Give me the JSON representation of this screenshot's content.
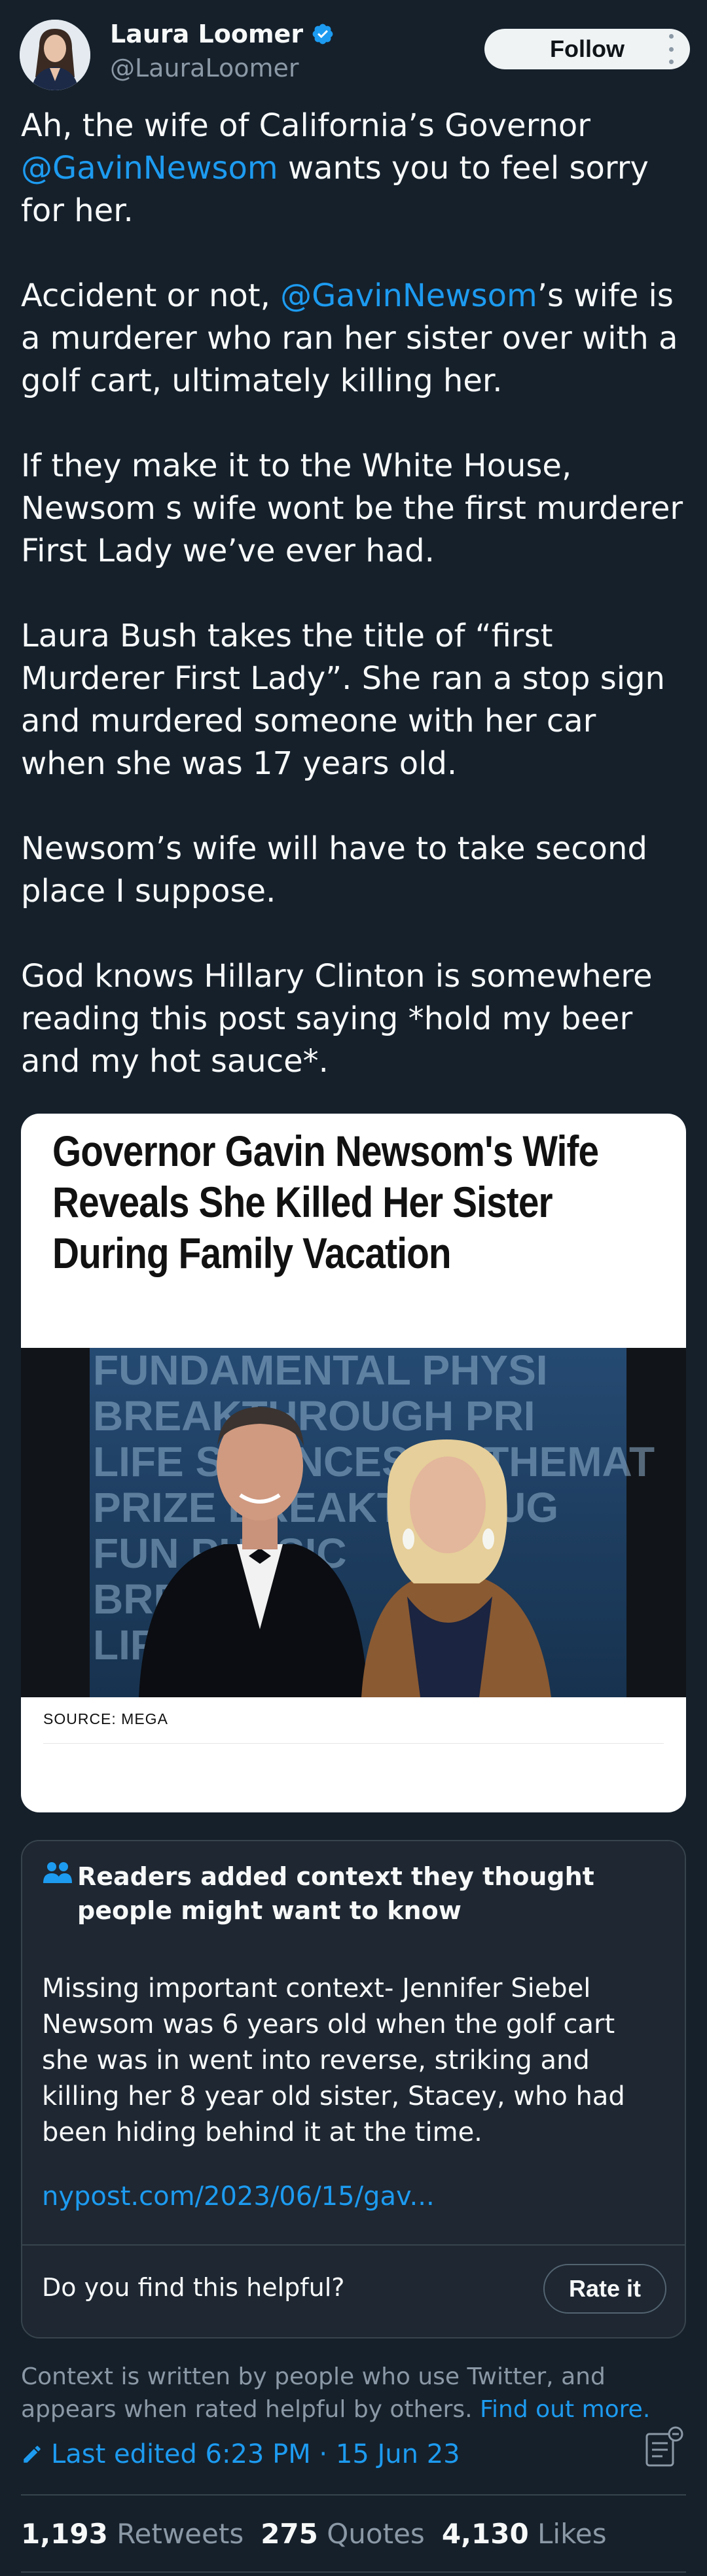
{
  "author": {
    "name": "Laura Loomer",
    "handle": "@LauraLoomer",
    "verified": true,
    "follow_label": "Follow"
  },
  "tweet": {
    "p1_pre": "Ah, the wife of California’s Governor ",
    "p1_mention": "@GavinNewsom",
    "p1_post": " wants you to feel sorry for her.",
    "p2_pre": "Accident or not, ",
    "p2_mention": "@GavinNewsom",
    "p2_post": "’s wife is a murderer who ran her sister over with a golf cart, ultimately killing her.",
    "p3": "If they make it to the White House, Newsom s wife wont be the first murderer First Lady we’ve ever had.",
    "p4": "Laura Bush takes the title of “first Murderer First Lady”. She ran a stop sign and murdered someone with her car when she was 17 years old.",
    "p5": "Newsom’s wife will have to take second place I suppose.",
    "p6": "God knows Hillary Clinton is somewhere reading this post saying *hold my beer and my hot sauce*."
  },
  "card": {
    "headline": "Governor Gavin Newsom's Wife Reveals She Killed Her Sister During Family Vacation",
    "source": "SOURCE: MEGA",
    "photo_backdrop_text": [
      "FUNDAMENTAL PHYSI",
      "BREAKTHROUGH PRI",
      "LIFE SCIENCES MATHEMAT",
      "PRIZE    BREAKTHROUG",
      "FUN       PHYSIC",
      "BRE          PRI",
      "LIF"
    ]
  },
  "note": {
    "title": "Readers added context they thought people might want to know",
    "body": "Missing important context- Jennifer Siebel Newsom was 6 years old when the golf cart she was in went into reverse, striking and killing her 8 year old sister, Stacey, who had been hiding behind it at the time.",
    "link": "nypost.com/2023/06/15/gav...",
    "helpful_question": "Do you find this helpful?",
    "rate_label": "Rate it"
  },
  "context": {
    "text": "Context is written by people who use Twitter, and appears when rated helpful by others. ",
    "find_more": "Find out more."
  },
  "edited": "Last edited 6:23 PM · 15 Jun 23",
  "stats": {
    "retweets_count": "1,193",
    "retweets_label": "Retweets",
    "quotes_count": "275",
    "quotes_label": "Quotes",
    "likes_count": "4,130",
    "likes_label": "Likes"
  },
  "colors": {
    "background": "#15202b",
    "accent": "#1d9bf0",
    "secondary_text": "#8b98a5",
    "border": "#38444d"
  },
  "icons": [
    "verified-badge-icon",
    "more-options-icon",
    "people-icon",
    "edit-pencil-icon",
    "notes-icon"
  ]
}
